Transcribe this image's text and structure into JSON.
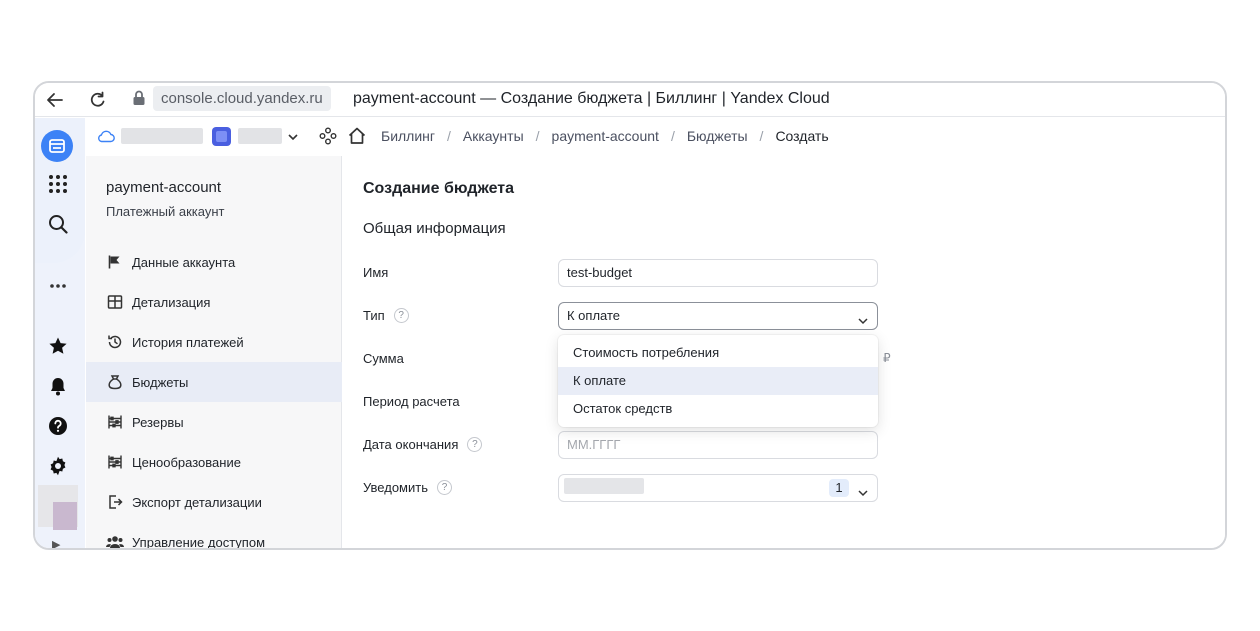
{
  "browser": {
    "url": "console.cloud.yandex.ru",
    "tab_title": "payment-account — Создание бюджета | Биллинг | Yandex Cloud"
  },
  "breadcrumbs": [
    "Биллинг",
    "Аккаунты",
    "payment-account",
    "Бюджеты",
    "Создать"
  ],
  "breadcrumb_sep": "/",
  "sidebar": {
    "account_name": "payment-account",
    "account_type": "Платежный аккаунт",
    "items": [
      {
        "label": "Данные аккаунта",
        "icon": "flag-icon"
      },
      {
        "label": "Детализация",
        "icon": "table-icon"
      },
      {
        "label": "История платежей",
        "icon": "history-icon"
      },
      {
        "label": "Бюджеты",
        "icon": "moneybag-icon",
        "active": true
      },
      {
        "label": "Резервы",
        "icon": "abacus-icon"
      },
      {
        "label": "Ценообразование",
        "icon": "abacus-icon"
      },
      {
        "label": "Экспорт детализации",
        "icon": "export-icon"
      },
      {
        "label": "Управление доступом",
        "icon": "users-icon"
      }
    ]
  },
  "form": {
    "title": "Создание бюджета",
    "section": "Общая информация",
    "name_label": "Имя",
    "name_value": "test-budget",
    "type_label": "Тип",
    "type_value": "К оплате",
    "sum_label": "Сумма",
    "currency": "₽",
    "period_label": "Период расчета",
    "end_date_label": "Дата окончания",
    "end_date_placeholder": "ММ.ГГГГ",
    "notify_label": "Уведомить",
    "notify_count": "1",
    "help_mark": "?"
  },
  "type_dropdown": {
    "options": [
      "Стоимость потребления",
      "К оплате",
      "Остаток средств"
    ],
    "selected": "К оплате"
  },
  "colors": {
    "accent": "#3c82f6",
    "selected_bg": "#e9edf7"
  }
}
